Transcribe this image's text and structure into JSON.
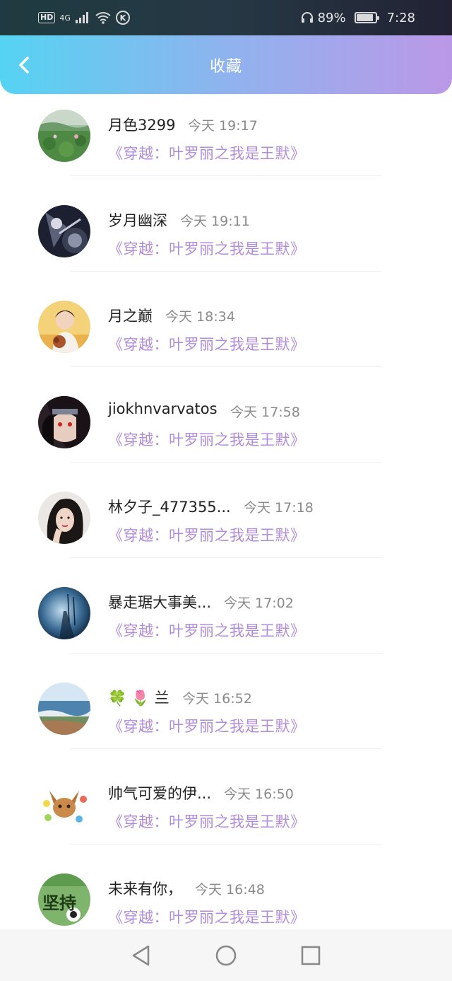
{
  "status_bar": {
    "hd": "HD",
    "network": "4G",
    "k_badge": "K",
    "battery_pct": "89%",
    "battery_level": 0.89,
    "time": "7:28"
  },
  "header": {
    "title": "收藏",
    "back_icon": "chevron-left-icon"
  },
  "list": {
    "items": [
      {
        "name": "月色3299",
        "time": "今天 19:17",
        "book": "《穿越：叶罗丽之我是王默》",
        "avatar": "lotus-pond"
      },
      {
        "name": "岁月幽深",
        "time": "今天 19:11",
        "book": "《穿越：叶罗丽之我是王默》",
        "avatar": "dark-anime"
      },
      {
        "name": "月之巅",
        "time": "今天 18:34",
        "book": "《穿越：叶罗丽之我是王默》",
        "avatar": "boy-with-dog"
      },
      {
        "name": "jiokhnvarvatos",
        "time": "今天 17:58",
        "book": "《穿越：叶罗丽之我是王默》",
        "avatar": "anime-ninja"
      },
      {
        "name": "林夕子_477355...",
        "time": "今天 17:18",
        "book": "《穿越：叶罗丽之我是王默》",
        "avatar": "woman-portrait"
      },
      {
        "name": "暴走琚大事美...",
        "time": "今天 17:02",
        "book": "《穿越：叶罗丽之我是王默》",
        "avatar": "blue-sky-road"
      },
      {
        "name": "🍀 🌷 兰",
        "time": "今天 16:52",
        "book": "《穿越：叶罗丽之我是王默》",
        "avatar": "seaside"
      },
      {
        "name": "帅气可爱的伊...",
        "time": "今天 16:50",
        "book": "《穿越：叶罗丽之我是王默》",
        "avatar": "eevee"
      },
      {
        "name": "未来有你，",
        "time": "今天 16:48",
        "book": "《穿越：叶罗丽之我是王默》",
        "avatar": "green-text",
        "avatar_text": "坚持"
      }
    ]
  },
  "navbar": {
    "back": "triangle-back-icon",
    "home": "circle-home-icon",
    "recent": "square-recent-icon"
  },
  "colors": {
    "header_start": "#55d3f2",
    "header_end": "#bb98e8",
    "book_title": "#b18bdc",
    "time": "#8a8a8a"
  }
}
